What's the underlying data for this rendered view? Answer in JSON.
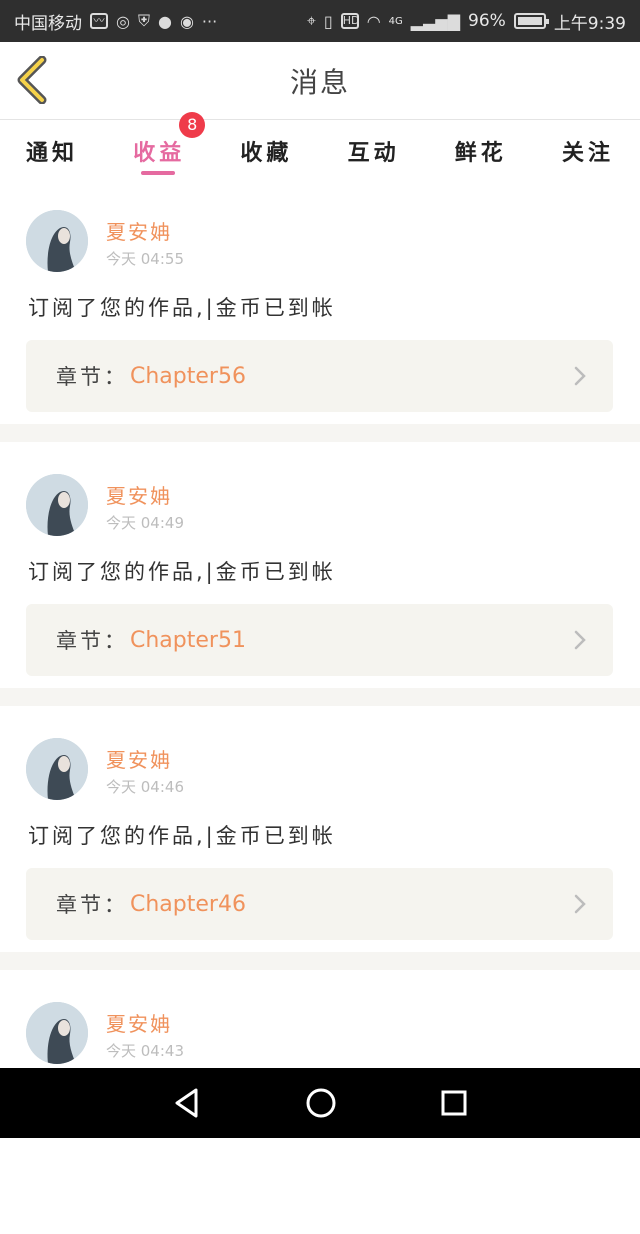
{
  "status_bar": {
    "carrier": "中国移动",
    "battery": "96%",
    "time": "上午9:39",
    "network": "4G",
    "icons": [
      "activity-icon",
      "weibo-icon",
      "shield-icon",
      "bulb-icon",
      "weibo-icon",
      "more-icon",
      "location-icon",
      "vibrate-icon",
      "hd-icon",
      "wifi-icon",
      "signal-icon",
      "battery-icon"
    ]
  },
  "header": {
    "title": "消息",
    "back_icon": "back-chevron-icon"
  },
  "tabs": [
    {
      "label": "通知",
      "active": false
    },
    {
      "label": "收益",
      "active": true,
      "badge": "8"
    },
    {
      "label": "收藏",
      "active": false
    },
    {
      "label": "互动",
      "active": false
    },
    {
      "label": "鲜花",
      "active": false
    },
    {
      "label": "关注",
      "active": false
    }
  ],
  "colors": {
    "accent": "#e56aa0",
    "badge": "#ef3b4a",
    "name": "#f0925c",
    "separator": "#f6f5f2"
  },
  "messages": [
    {
      "name": "夏安姌",
      "time": "今天 04:55",
      "text": "订阅了您的作品,|金币已到帐",
      "chapter_label": "章节：",
      "chapter": "Chapter56"
    },
    {
      "name": "夏安姌",
      "time": "今天 04:49",
      "text": "订阅了您的作品,|金币已到帐",
      "chapter_label": "章节：",
      "chapter": "Chapter51"
    },
    {
      "name": "夏安姌",
      "time": "今天 04:46",
      "text": "订阅了您的作品,|金币已到帐",
      "chapter_label": "章节：",
      "chapter": "Chapter46"
    },
    {
      "name": "夏安姌",
      "time": "今天 04:43"
    }
  ],
  "nav_bar": {
    "icons": [
      "back-triangle-icon",
      "home-circle-icon",
      "recents-square-icon"
    ]
  }
}
